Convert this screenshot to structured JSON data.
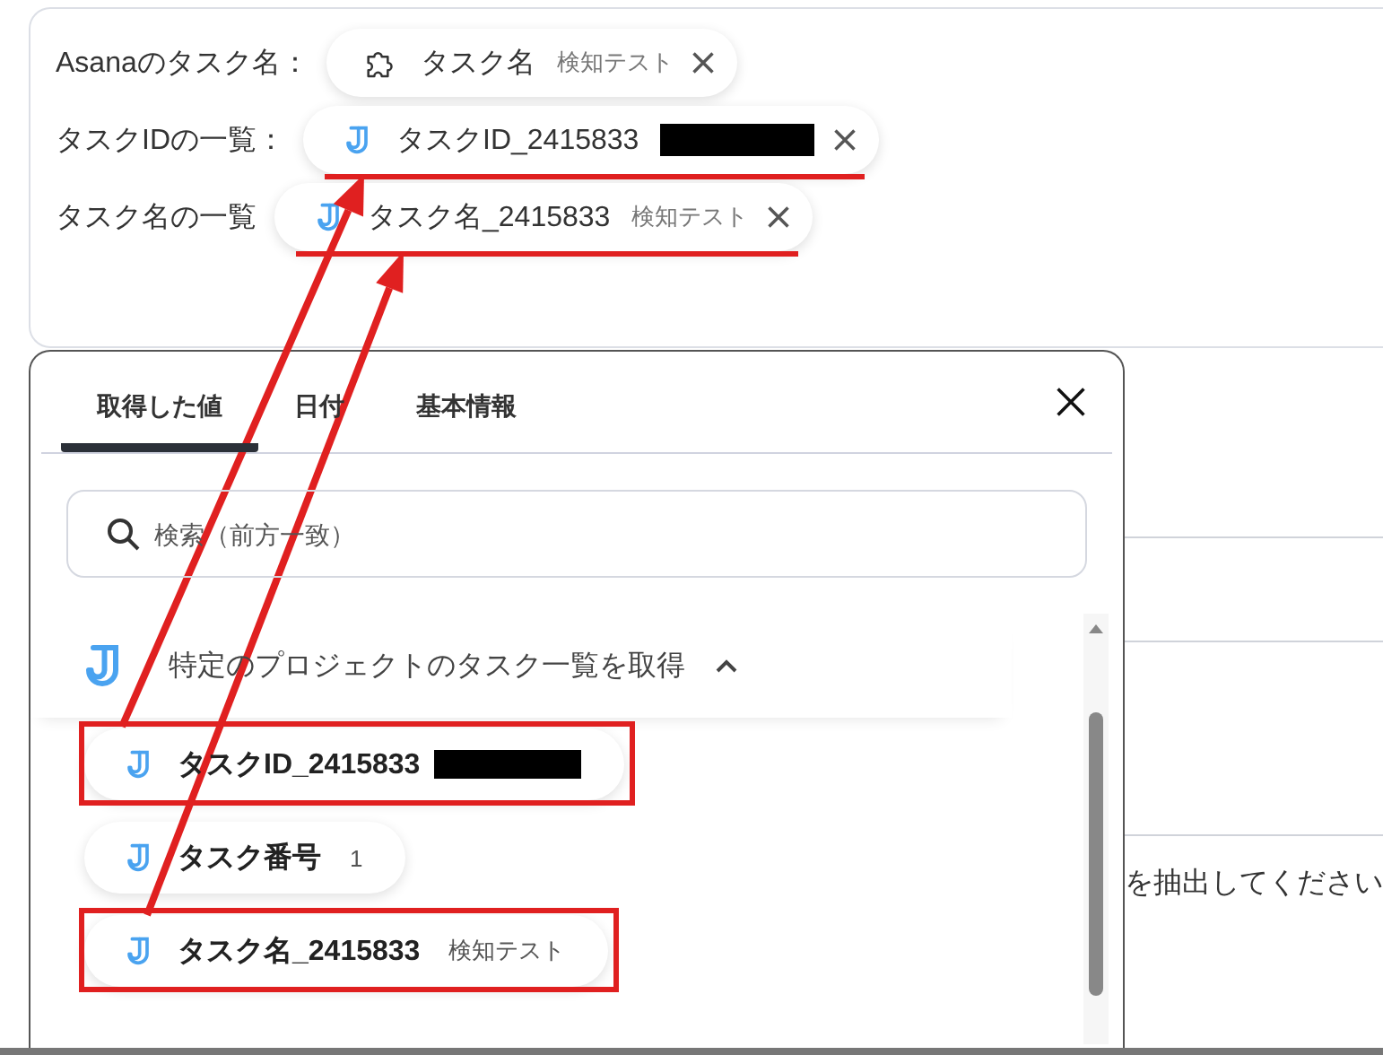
{
  "top_card": {
    "fields": [
      {
        "label": "Asanaのタスク名：",
        "chip": {
          "kind": "puzzle",
          "name": "タスク名",
          "value": "検知テスト",
          "redacted": false,
          "underlined": false
        }
      },
      {
        "label": "タスクIDの一覧：",
        "chip": {
          "kind": "app",
          "name": "タスクID_2415833",
          "redacted": true,
          "underlined": true
        }
      },
      {
        "label": "タスク名の一覧",
        "chip": {
          "kind": "app",
          "name": "タスク名_2415833",
          "value": "検知テスト",
          "redacted": false,
          "underlined": true
        }
      }
    ]
  },
  "panel": {
    "tabs": [
      {
        "label": "取得した値",
        "selected": true
      },
      {
        "label": "日付",
        "selected": false
      },
      {
        "label": "基本情報",
        "selected": false
      }
    ],
    "search": {
      "placeholder": "検索（前方一致）"
    },
    "section": {
      "title": "特定のプロジェクトのタスク一覧を取得",
      "expanded": true
    },
    "items": [
      {
        "name": "タスクID_2415833",
        "redacted": true,
        "highlighted": true
      },
      {
        "name": "タスク番号",
        "value": "1",
        "redacted": false,
        "highlighted": false
      },
      {
        "name": "タスク名_2415833",
        "value": "検知テスト",
        "redacted": false,
        "highlighted": true
      }
    ]
  },
  "background_text": "を抽出してください"
}
